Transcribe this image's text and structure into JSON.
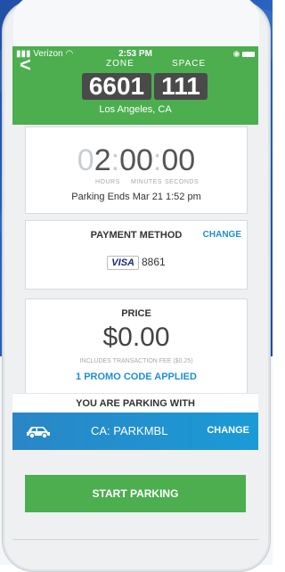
{
  "status_bar": {
    "carrier": "Verizon",
    "time": "2:53 PM"
  },
  "header": {
    "zone_label": "ZONE",
    "space_label": "SPACE",
    "zone_number": "6601",
    "space_number": "111",
    "city": "Los Angeles, CA",
    "back_icon": "chevron-left-icon"
  },
  "timer": {
    "lead": "0",
    "hours": "2",
    "minutes": "00",
    "seconds": "00",
    "separator": ":",
    "unit_hours": "HOURS",
    "unit_minutes": "MINUTES",
    "unit_seconds": "SECONDS",
    "ends": "Parking Ends Mar 21 1:52 pm"
  },
  "payment": {
    "title": "PAYMENT METHOD",
    "change": "CHANGE",
    "card_brand": "VISA",
    "card_last4": "8861"
  },
  "price": {
    "title": "PRICE",
    "amount": "$0.00",
    "fee_note": "INCLUDES TRANSACTION FEE ($0.25)",
    "promo": "1 PROMO CODE APPLIED"
  },
  "vehicle": {
    "heading": "YOU ARE PARKING WITH",
    "plate": "CA: PARKMBL",
    "change": "CHANGE",
    "icon": "car-icon"
  },
  "actions": {
    "start": "START PARKING"
  },
  "colors": {
    "header_green": "#4cae4f",
    "accent_blue": "#1e8fd4",
    "vehicle_bar": "#2a86c6"
  }
}
